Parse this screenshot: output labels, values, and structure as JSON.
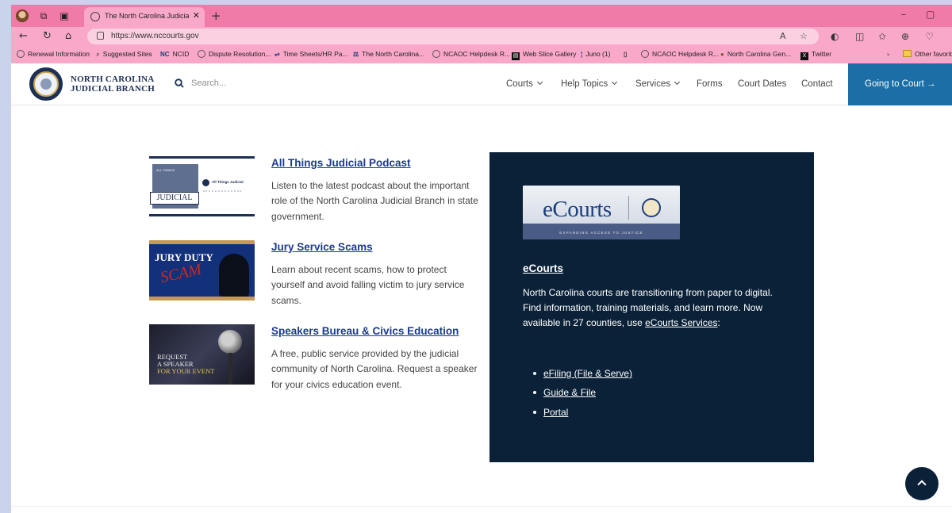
{
  "browser": {
    "tab_title": "The North Carolina Judicial Bran",
    "url": "https://www.nccourts.gov",
    "favorites": [
      {
        "label": "Renewal Information",
        "icon": "circle-icon"
      },
      {
        "label": "Suggested Sites",
        "icon": "search-icon"
      },
      {
        "label": "NCID",
        "icon": "nc-icon"
      },
      {
        "label": "Dispute Resolution...",
        "icon": "circle-icon"
      },
      {
        "label": "Time Sheets/HR Pa...",
        "icon": "link-icon"
      },
      {
        "label": "The North Carolina...",
        "icon": "seal-icon"
      },
      {
        "label": "NCAOC Helpdesk R...",
        "icon": "circle-icon"
      },
      {
        "label": "Web Slice Gallery",
        "icon": "slice-icon"
      },
      {
        "label": "Juno (1)",
        "icon": "juno-icon"
      },
      {
        "label": "",
        "icon": "page-icon"
      },
      {
        "label": "NCAOC Helpdesk R...",
        "icon": "circle-icon"
      },
      {
        "label": "North Carolina Gen...",
        "icon": "nc-icon"
      },
      {
        "label": "Twitter",
        "icon": "x-icon"
      },
      {
        "label": "Other favorit",
        "icon": "folder-icon"
      }
    ]
  },
  "header": {
    "brand_line1": "NORTH CAROLINA",
    "brand_line2": "JUDICIAL BRANCH",
    "search_placeholder": "Search...",
    "nav": [
      "Courts",
      "Help Topics",
      "Services",
      "Forms",
      "Court Dates",
      "Contact"
    ],
    "cta": "Going to Court →"
  },
  "features": [
    {
      "title": "All Things Judicial Podcast",
      "desc": "Listen to the latest podcast about the important role of the North Carolina Judicial Branch in state government.",
      "thumb_text": [
        "JUDICIAL",
        "All Things Judicial",
        "ALL THINGS"
      ]
    },
    {
      "title": "Jury Service Scams",
      "desc": "Learn about recent scams, how to protect yourself and avoid falling victim to jury service scams.",
      "thumb_text": [
        "JURY DUTY",
        "SCAM"
      ]
    },
    {
      "title": "Speakers Bureau & Civics Education",
      "desc": "A free, public service provided by the judicial community of North Carolina. Request a speaker for your civics education event.",
      "thumb_text": [
        "REQUEST",
        "A SPEAKER",
        "FOR YOUR EVENT"
      ]
    }
  ],
  "ecourts": {
    "logo_word": "eCourts",
    "logo_tagline": "EXPANDING ACCESS TO JUSTICE",
    "title": "eCourts",
    "desc_main": "North Carolina courts are transitioning from paper to digital. Find information, training materials, and learn more. Now available in 27 counties, use ",
    "desc_link": "eCourts Services",
    "desc_end": ":",
    "links": [
      "eFiling (File & Serve)",
      "Guide & File",
      "Portal"
    ]
  },
  "colors": {
    "tab_bar": "#f07aa8",
    "chrome": "#f9a8c9",
    "cta_bg": "#1b6fa6",
    "card_bg": "#0a2138",
    "link": "#1b3a8f"
  }
}
